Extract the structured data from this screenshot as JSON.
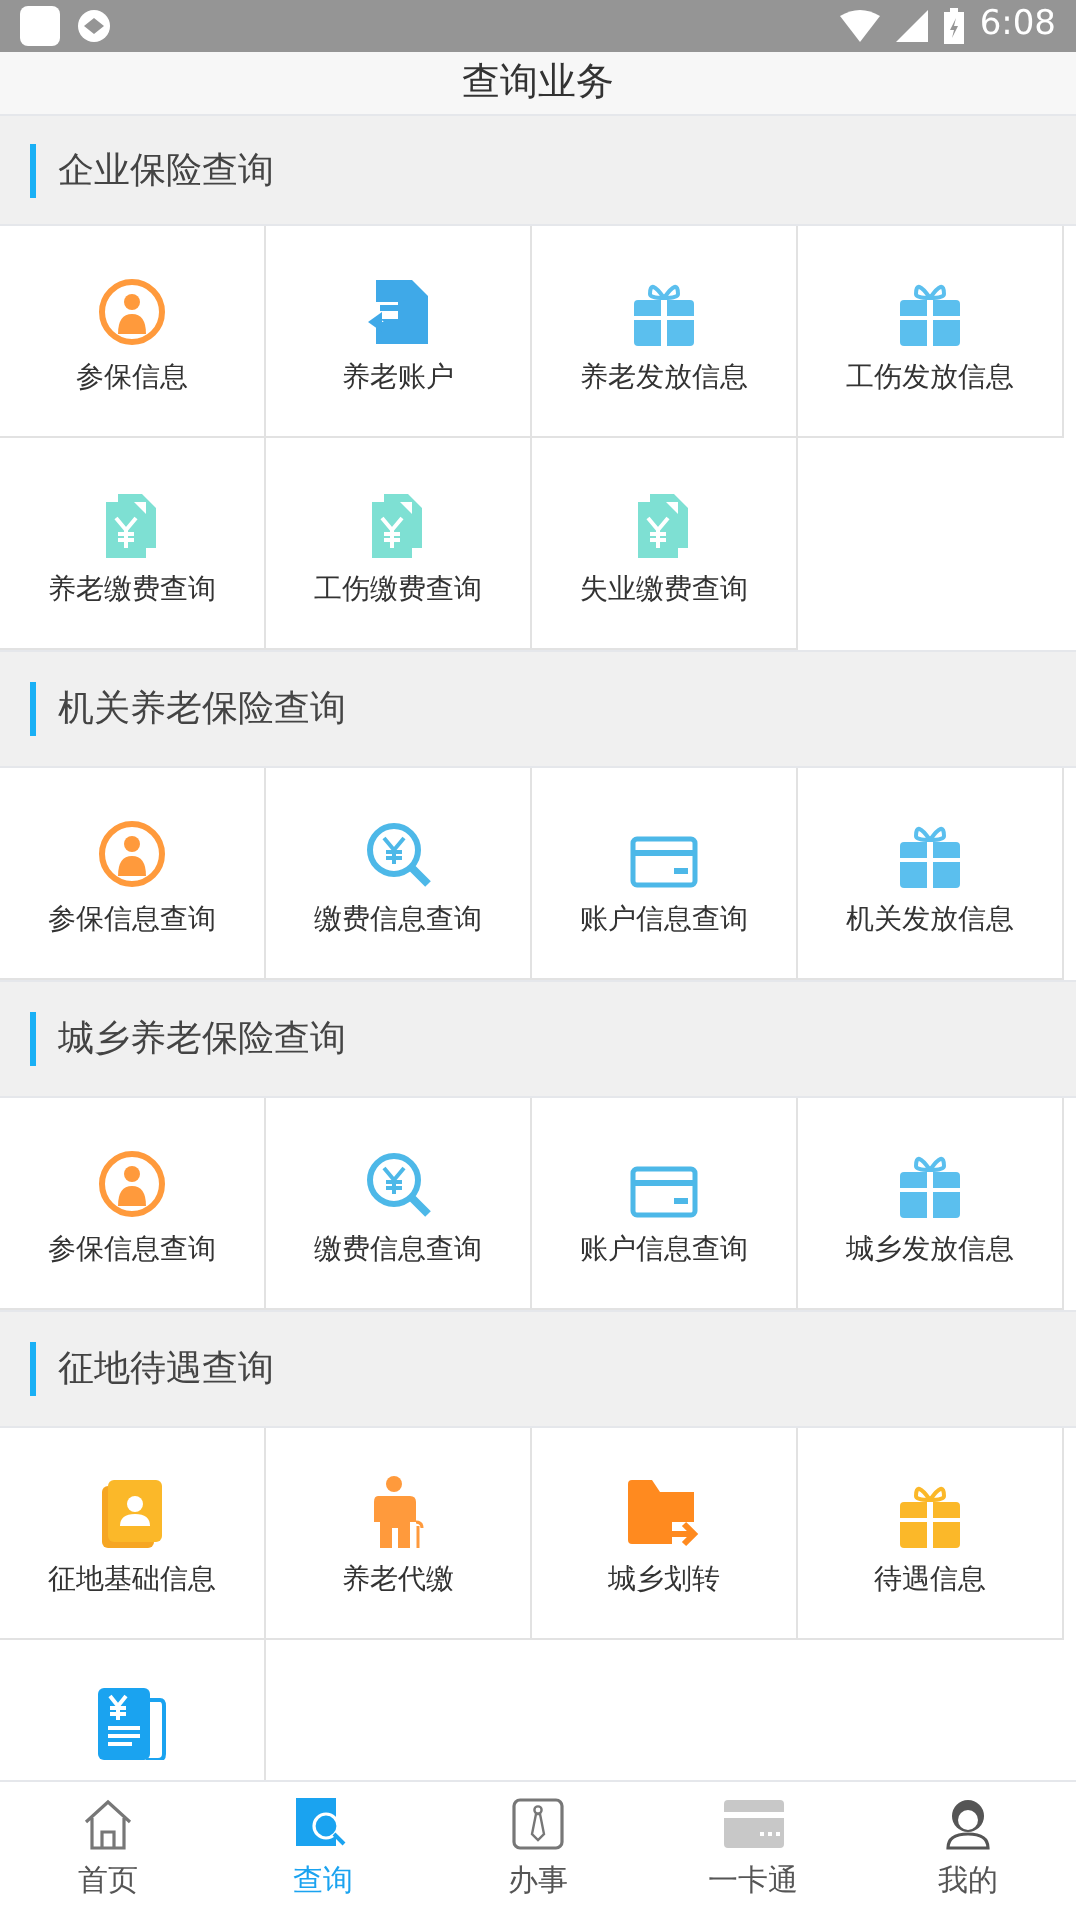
{
  "status_bar": {
    "time": "6:08"
  },
  "title": "查询业务",
  "sections": [
    {
      "title": "企业保险查询",
      "items": [
        {
          "label": "参保信息",
          "kind": "person"
        },
        {
          "label": "养老账户",
          "kind": "transfer"
        },
        {
          "label": "养老发放信息",
          "kind": "gift"
        },
        {
          "label": "工伤发放信息",
          "kind": "gift"
        },
        {
          "label": "养老缴费查询",
          "kind": "bill"
        },
        {
          "label": "工伤缴费查询",
          "kind": "bill"
        },
        {
          "label": "失业缴费查询",
          "kind": "bill"
        }
      ]
    },
    {
      "title": "机关养老保险查询",
      "items": [
        {
          "label": "参保信息查询",
          "kind": "person"
        },
        {
          "label": "缴费信息查询",
          "kind": "magnifier"
        },
        {
          "label": "账户信息查询",
          "kind": "card"
        },
        {
          "label": "机关发放信息",
          "kind": "gift"
        }
      ]
    },
    {
      "title": "城乡养老保险查询",
      "items": [
        {
          "label": "参保信息查询",
          "kind": "person"
        },
        {
          "label": "缴费信息查询",
          "kind": "magnifier"
        },
        {
          "label": "账户信息查询",
          "kind": "card"
        },
        {
          "label": "城乡发放信息",
          "kind": "gift"
        }
      ]
    },
    {
      "title": "征地待遇查询",
      "items": [
        {
          "label": "征地基础信息",
          "kind": "contact"
        },
        {
          "label": "养老代缴",
          "kind": "elder"
        },
        {
          "label": "城乡划转",
          "kind": "folder"
        },
        {
          "label": "待遇信息",
          "kind": "gift_gold"
        },
        {
          "kind": "newspaper"
        }
      ]
    }
  ],
  "nav": [
    {
      "label": "首页",
      "kind": "home",
      "selected": false
    },
    {
      "label": "查询",
      "kind": "search",
      "selected": true
    },
    {
      "label": "办事",
      "kind": "tie",
      "selected": false
    },
    {
      "label": "一卡通",
      "kind": "card",
      "selected": false
    },
    {
      "label": "我的",
      "kind": "user",
      "selected": false
    }
  ]
}
